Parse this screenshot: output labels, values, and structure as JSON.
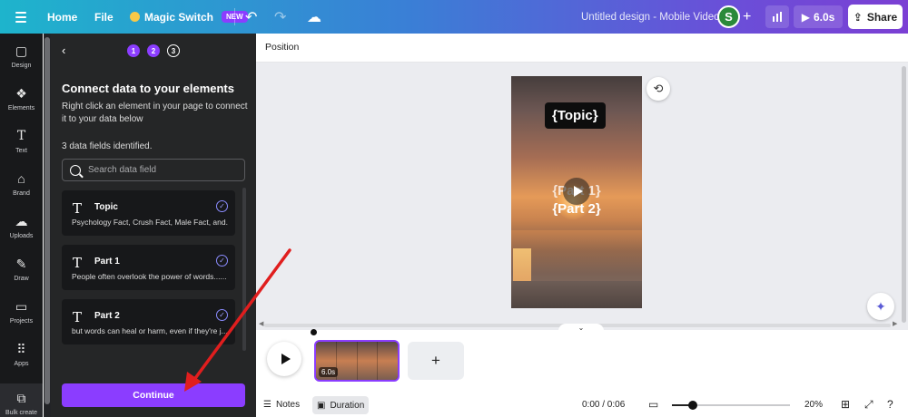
{
  "topbar": {
    "home": "Home",
    "file": "File",
    "magic_switch": "Magic Switch",
    "new_badge": "NEW",
    "doc_title": "Untitled design - Mobile Video",
    "avatar_initial": "S",
    "play_duration": "6.0s",
    "share": "Share"
  },
  "rail": {
    "items": [
      {
        "label": "Design",
        "icon": "design-icon"
      },
      {
        "label": "Elements",
        "icon": "elements-icon"
      },
      {
        "label": "Text",
        "icon": "text-icon"
      },
      {
        "label": "Brand",
        "icon": "brand-icon"
      },
      {
        "label": "Uploads",
        "icon": "uploads-icon"
      },
      {
        "label": "Draw",
        "icon": "draw-icon"
      },
      {
        "label": "Projects",
        "icon": "projects-icon"
      },
      {
        "label": "Apps",
        "icon": "apps-icon"
      },
      {
        "label": "Bulk create",
        "icon": "bulk-create-icon"
      }
    ]
  },
  "panel": {
    "steps": [
      "1",
      "2",
      "3"
    ],
    "title": "Connect data to your elements",
    "description": "Right click an element in your page to connect it to your data below",
    "fields_count": "3 data fields identified.",
    "search_placeholder": "Search data field",
    "fields": [
      {
        "name": "Topic",
        "value": "Psychology Fact, Crush Fact, Male Fact, and..."
      },
      {
        "name": "Part 1",
        "value": "People often overlook the power of words......"
      },
      {
        "name": "Part 2",
        "value": "but words can heal or harm, even if they're j..."
      }
    ],
    "continue": "Continue"
  },
  "canvas": {
    "context_label": "Position",
    "topic_text": "{Topic}",
    "part1_text": "{Part 1}",
    "part2_text": "{Part 2}"
  },
  "timeline": {
    "clip_duration": "6.0s",
    "add": "+"
  },
  "bottombar": {
    "notes": "Notes",
    "duration": "Duration",
    "time": "0:00 / 0:06",
    "zoom": "20%",
    "zoom_fraction": 0.18
  },
  "colors": {
    "accent": "#8b3dff",
    "panel_bg": "#252627",
    "rail_bg": "#18191b",
    "annotation_arrow": "#e01e1e"
  }
}
